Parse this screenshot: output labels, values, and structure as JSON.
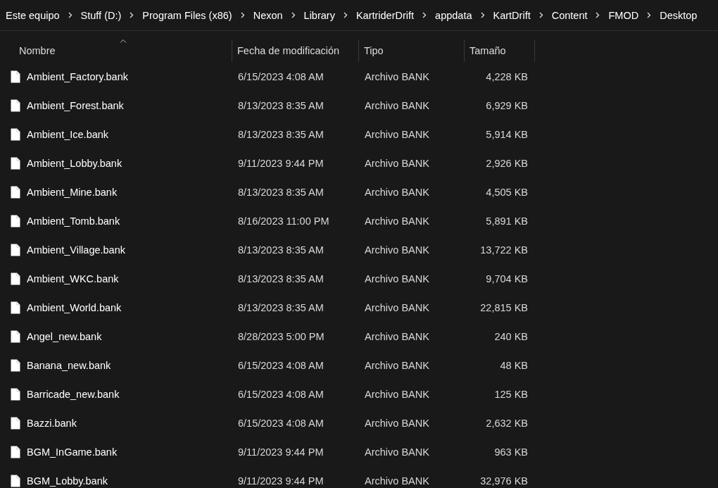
{
  "breadcrumb": [
    "Este equipo",
    "Stuff (D:)",
    "Program Files (x86)",
    "Nexon",
    "Library",
    "KartriderDrift",
    "appdata",
    "KartDrift",
    "Content",
    "FMOD",
    "Desktop"
  ],
  "table": {
    "columns": [
      {
        "label": "Nombre",
        "sorted": true
      },
      {
        "label": "Fecha de modificación",
        "sorted": false
      },
      {
        "label": "Tipo",
        "sorted": false
      },
      {
        "label": "Tamaño",
        "sorted": false
      }
    ],
    "rows": [
      [
        "Ambient_Factory.bank",
        "6/15/2023 4:08 AM",
        "Archivo BANK",
        "4,228 KB"
      ],
      [
        "Ambient_Forest.bank",
        "8/13/2023 8:35 AM",
        "Archivo BANK",
        "6,929 KB"
      ],
      [
        "Ambient_Ice.bank",
        "8/13/2023 8:35 AM",
        "Archivo BANK",
        "5,914 KB"
      ],
      [
        "Ambient_Lobby.bank",
        "9/11/2023 9:44 PM",
        "Archivo BANK",
        "2,926 KB"
      ],
      [
        "Ambient_Mine.bank",
        "8/13/2023 8:35 AM",
        "Archivo BANK",
        "4,505 KB"
      ],
      [
        "Ambient_Tomb.bank",
        "8/16/2023 11:00 PM",
        "Archivo BANK",
        "5,891 KB"
      ],
      [
        "Ambient_Village.bank",
        "8/13/2023 8:35 AM",
        "Archivo BANK",
        "13,722 KB"
      ],
      [
        "Ambient_WKC.bank",
        "8/13/2023 8:35 AM",
        "Archivo BANK",
        "9,704 KB"
      ],
      [
        "Ambient_World.bank",
        "8/13/2023 8:35 AM",
        "Archivo BANK",
        "22,815 KB"
      ],
      [
        "Angel_new.bank",
        "8/28/2023 5:00 PM",
        "Archivo BANK",
        "240 KB"
      ],
      [
        "Banana_new.bank",
        "6/15/2023 4:08 AM",
        "Archivo BANK",
        "48 KB"
      ],
      [
        "Barricade_new.bank",
        "6/15/2023 4:08 AM",
        "Archivo BANK",
        "125 KB"
      ],
      [
        "Bazzi.bank",
        "6/15/2023 4:08 AM",
        "Archivo BANK",
        "2,632 KB"
      ],
      [
        "BGM_InGame.bank",
        "9/11/2023 9:44 PM",
        "Archivo BANK",
        "963 KB"
      ],
      [
        "BGM_Lobby.bank",
        "9/11/2023 9:44 PM",
        "Archivo BANK",
        "32,976 KB"
      ]
    ]
  }
}
